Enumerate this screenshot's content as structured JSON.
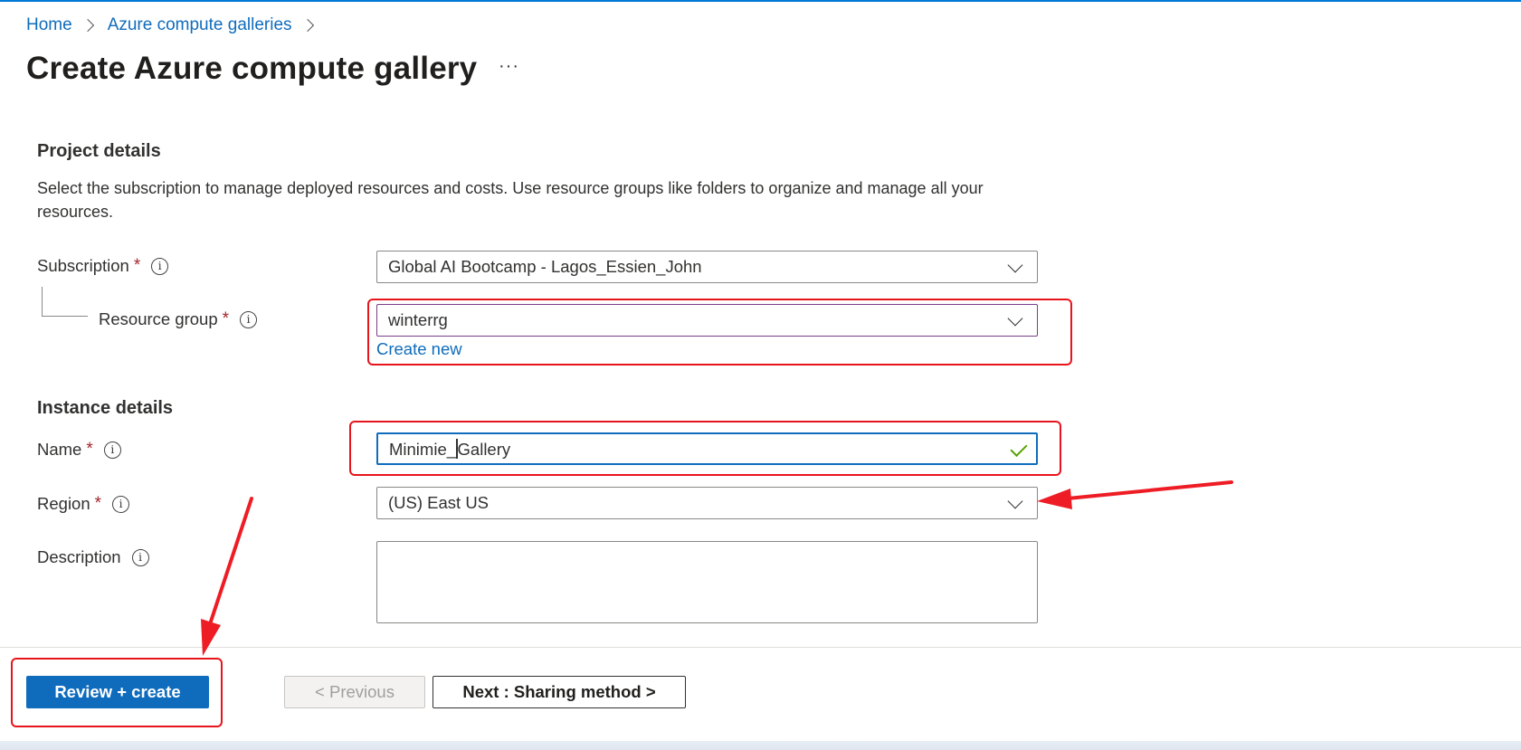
{
  "breadcrumb": {
    "items": [
      "Home",
      "Azure compute galleries"
    ]
  },
  "page": {
    "title": "Create Azure compute gallery",
    "more_label": "···"
  },
  "project_details": {
    "heading": "Project details",
    "description": "Select the subscription to manage deployed resources and costs. Use resource groups like folders to organize and manage all your resources.",
    "subscription": {
      "label": "Subscription",
      "value": "Global AI Bootcamp - Lagos_Essien_John"
    },
    "resource_group": {
      "label": "Resource group",
      "value": "winterrg",
      "create_new": "Create new"
    }
  },
  "instance_details": {
    "heading": "Instance details",
    "name": {
      "label": "Name",
      "value_before_caret": "Minimie_",
      "value_after_caret": "Gallery"
    },
    "region": {
      "label": "Region",
      "value": "(US) East US"
    },
    "description": {
      "label": "Description",
      "value": ""
    }
  },
  "common": {
    "required_mark": "*",
    "info_glyph": "i"
  },
  "footer": {
    "review_create": "Review + create",
    "previous": "< Previous",
    "next": "Next : Sharing method >"
  },
  "colors": {
    "accent": "#0f6cbd",
    "highlight": "#e8141c",
    "valid": "#57a300"
  },
  "icons": [
    "chevron-right-icon",
    "more-icon",
    "info-icon",
    "chevron-down-icon",
    "checkmark-icon",
    "annotation-arrow"
  ]
}
